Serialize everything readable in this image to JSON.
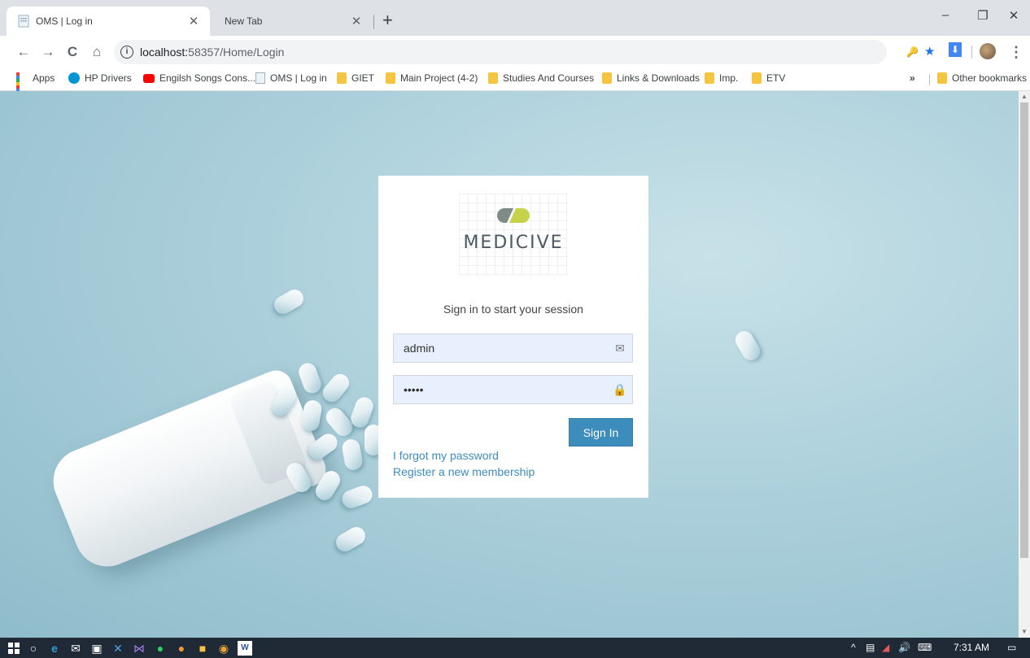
{
  "browser": {
    "tabs": [
      {
        "title": "OMS | Log in",
        "active": true
      },
      {
        "title": "New Tab",
        "active": false
      }
    ],
    "new_tab_label": "+",
    "window_controls": {
      "minimize": "–",
      "restore": "❐",
      "close": "✕"
    },
    "tab_close": "✕",
    "nav": {
      "back": "←",
      "forward": "→",
      "reload": "C",
      "home": "⌂"
    },
    "url": {
      "info": "i",
      "host": "localhost:",
      "path": "58357/Home/Login"
    },
    "toolbar_icons": {
      "key": "🔑",
      "star": "★",
      "download": "⬇",
      "menu": "⋮"
    },
    "bookmarks": [
      {
        "label": "Apps",
        "icon": "apps-grid"
      },
      {
        "label": "HP Drivers",
        "icon": "hp-icon"
      },
      {
        "label": "Engilsh Songs Cons...",
        "icon": "youtube-icon"
      },
      {
        "label": "OMS | Log in",
        "icon": "page-icon"
      },
      {
        "label": "GIET",
        "icon": "folder-icon"
      },
      {
        "label": "Main Project (4-2)",
        "icon": "folder-icon"
      },
      {
        "label": "Studies And Courses",
        "icon": "folder-icon"
      },
      {
        "label": "Links & Downloads",
        "icon": "folder-icon"
      },
      {
        "label": "Imp.",
        "icon": "folder-icon"
      },
      {
        "label": "ETV",
        "icon": "folder-icon"
      }
    ],
    "overflow_label": "»",
    "other_bookmarks_label": "Other bookmarks"
  },
  "login": {
    "brand": "MEDICIVE",
    "message": "Sign in to start your session",
    "username": {
      "value": "admin",
      "icon": "envelope-icon",
      "icon_glyph": "✉"
    },
    "password": {
      "value": "12345",
      "icon": "lock-icon",
      "icon_glyph": "🔒"
    },
    "sign_in_label": "Sign In",
    "forgot_link": "I forgot my password",
    "register_link": "Register a new membership",
    "colors": {
      "primary": "#3c8dbc",
      "field_bg": "#e8f0fe"
    }
  },
  "taskbar": {
    "time": "7:31 AM",
    "tray_arrow": "^",
    "keyboard_icon": "⌨",
    "speaker_icon": "🔊"
  }
}
